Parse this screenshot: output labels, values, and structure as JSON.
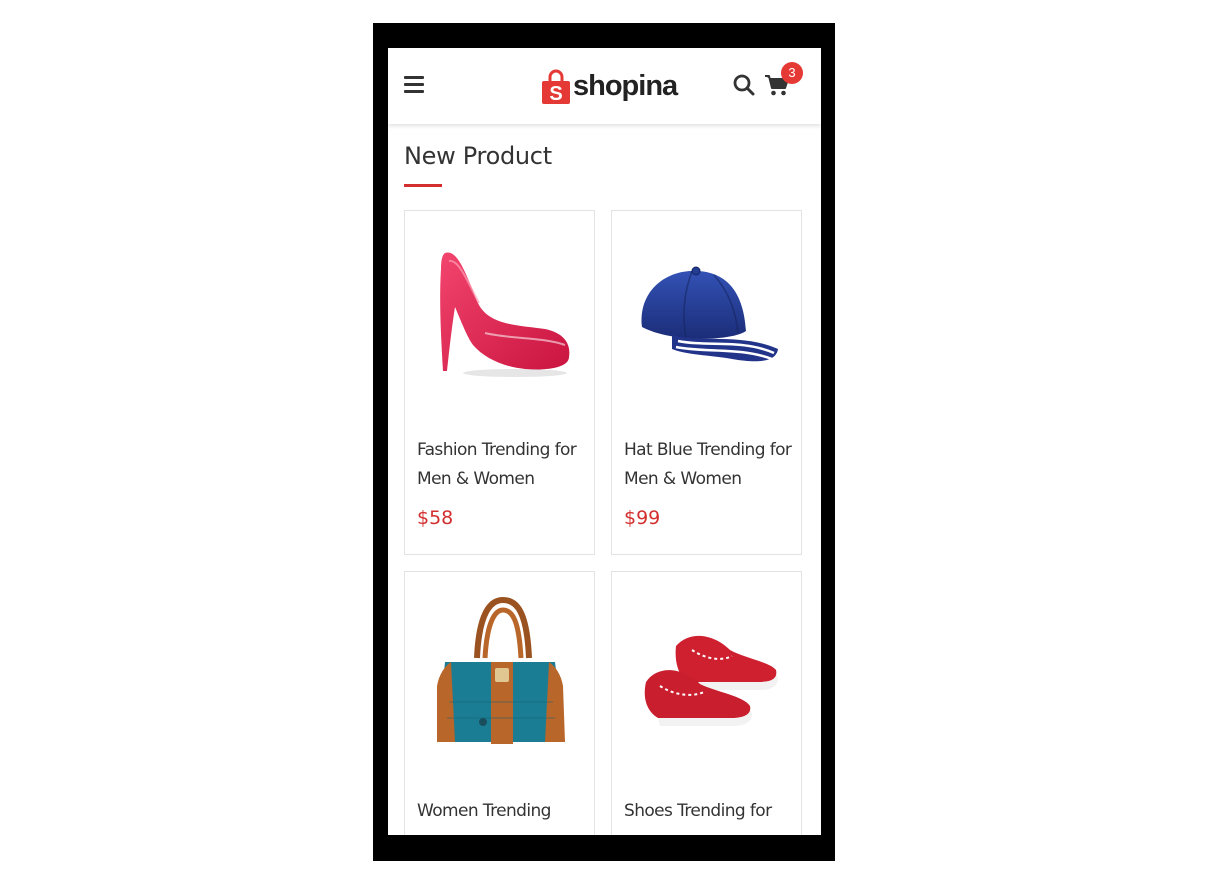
{
  "header": {
    "logo_text": "shopina",
    "logo_letter": "S",
    "cart_count": "3"
  },
  "section": {
    "title": "New Product"
  },
  "products": [
    {
      "name": "Fashion Trending for Men & Women",
      "price": "$58",
      "image": "red-high-heel"
    },
    {
      "name": "Hat Blue Trending for Men & Women",
      "price": "$99",
      "image": "blue-cap"
    },
    {
      "name": "Women Trending",
      "price": "",
      "image": "teal-handbag"
    },
    {
      "name": "Shoes Trending for",
      "price": "",
      "image": "red-boat-shoes"
    }
  ],
  "colors": {
    "accent": "#d32f2f",
    "badge": "#e53935",
    "frame": "#000000"
  }
}
